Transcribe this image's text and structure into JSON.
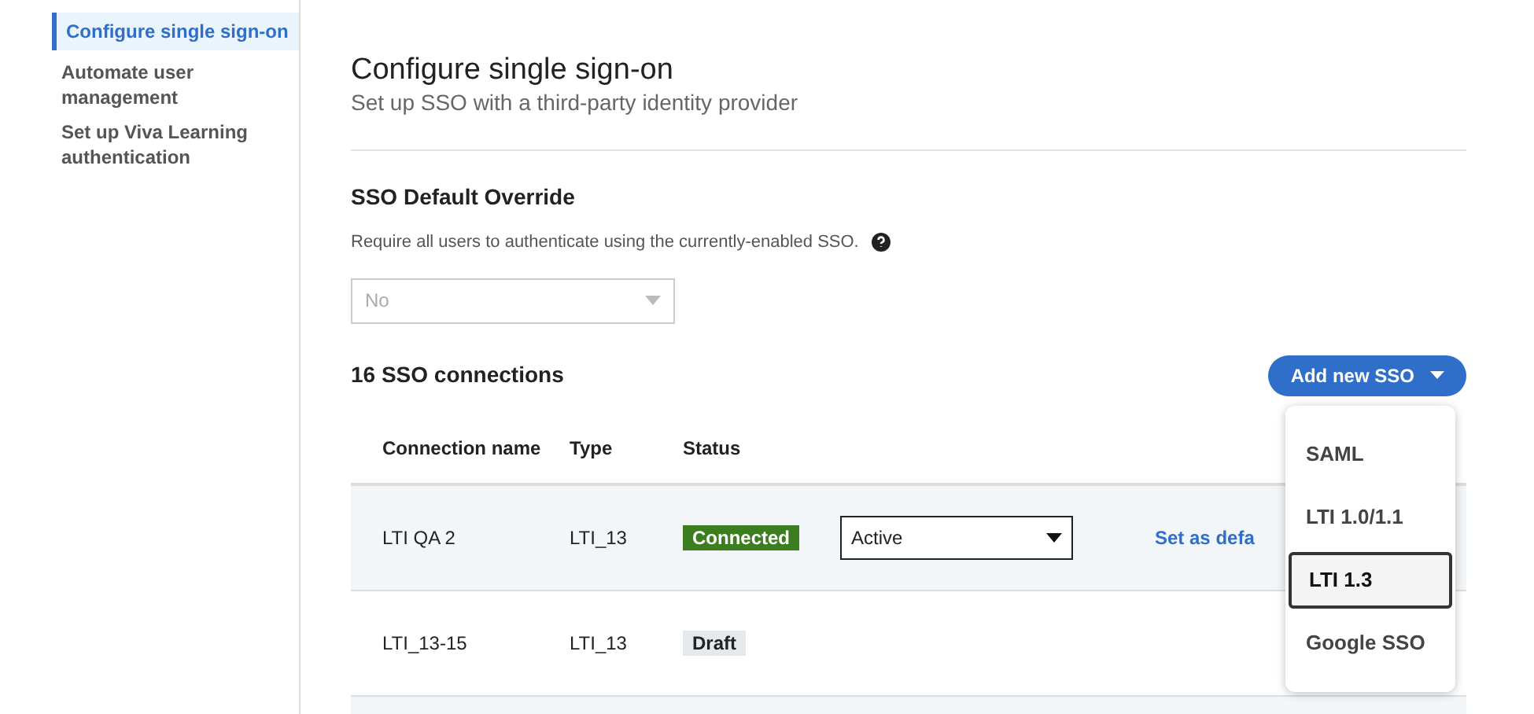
{
  "sidebar": {
    "items": [
      {
        "label": "Configure single sign-on",
        "selected": true
      },
      {
        "label": "Automate user management",
        "selected": false
      },
      {
        "label": "Set up Viva Learning authentication",
        "selected": false
      }
    ]
  },
  "header": {
    "title": "Configure single sign-on",
    "subtitle": "Set up SSO with a third-party identity provider"
  },
  "override": {
    "title": "SSO Default Override",
    "description": "Require all users to authenticate using the currently-enabled SSO.",
    "select": {
      "value": "No",
      "disabled": true
    }
  },
  "connections": {
    "count_label": "16 SSO connections",
    "add_button": "Add new SSO",
    "columns": [
      "Connection name",
      "Type",
      "Status"
    ],
    "rows": [
      {
        "name": "LTI QA 2",
        "type": "LTI_13",
        "status": {
          "label": "Connected",
          "kind": "connected"
        },
        "select": "Active",
        "link": "Set as defa",
        "highlighted": true
      },
      {
        "name": "LTI_13-15",
        "type": "LTI_13",
        "status": {
          "label": "Draft",
          "kind": "draft"
        },
        "highlighted": false
      }
    ]
  },
  "menu": {
    "items": [
      {
        "label": "SAML",
        "selected": false
      },
      {
        "label": "LTI 1.0/1.1",
        "selected": false
      },
      {
        "label": "LTI 1.3",
        "selected": true
      },
      {
        "label": "Google SSO",
        "selected": false
      }
    ]
  }
}
